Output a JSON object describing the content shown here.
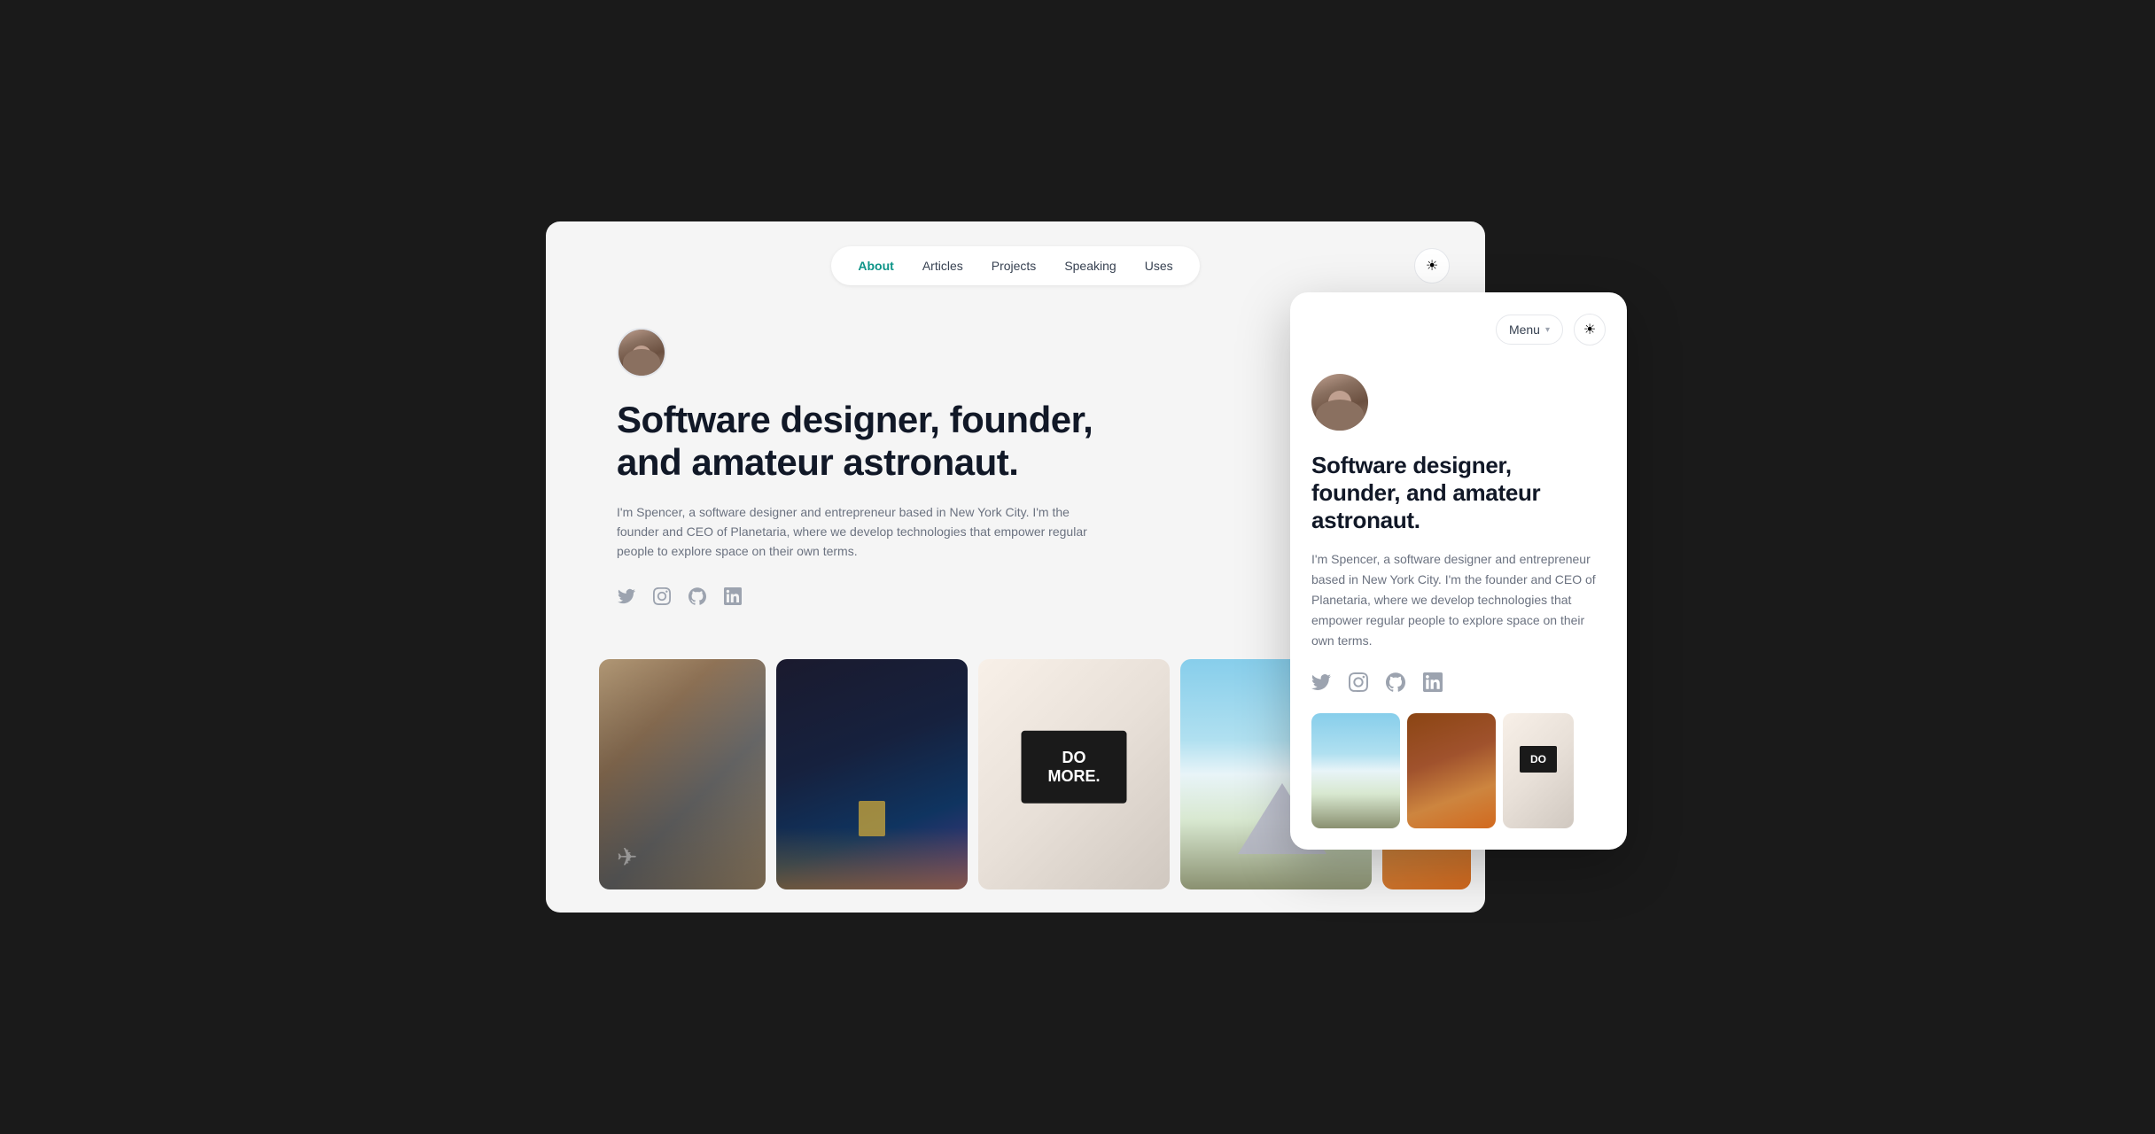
{
  "nav": {
    "items": [
      {
        "label": "About",
        "active": true
      },
      {
        "label": "Articles",
        "active": false
      },
      {
        "label": "Projects",
        "active": false
      },
      {
        "label": "Speaking",
        "active": false
      },
      {
        "label": "Uses",
        "active": false
      }
    ],
    "theme_icon": "☀"
  },
  "hero": {
    "title": "Software designer, founder, and amateur astronaut.",
    "description": "I'm Spencer, a software designer and entrepreneur based in New York City. I'm the founder and CEO of Planetaria, where we develop technologies that empower regular people to explore space on their own terms.",
    "social_links": [
      "twitter",
      "instagram",
      "github",
      "linkedin"
    ]
  },
  "mobile": {
    "menu_label": "Menu",
    "theme_icon": "☀",
    "title": "Software designer, founder, and amateur astronaut.",
    "description": "I'm Spencer, a software designer and entrepreneur based in New York City. I'm the founder and CEO of Planetaria, where we develop technologies that empower regular people to explore space on their own terms.",
    "social_links": [
      "twitter",
      "instagram",
      "github",
      "linkedin"
    ]
  },
  "colors": {
    "active_nav": "#0d9488",
    "title": "#111827",
    "description": "#6b7280",
    "social": "#9ca3af"
  }
}
